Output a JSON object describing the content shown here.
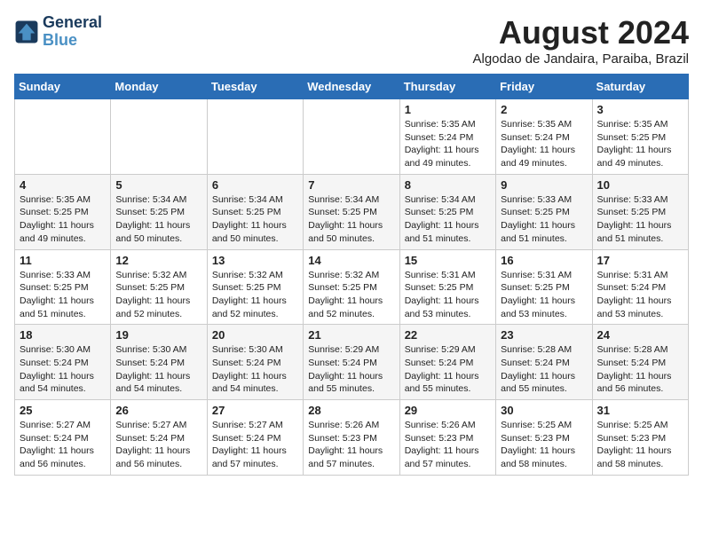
{
  "header": {
    "logo_line1": "General",
    "logo_line2": "Blue",
    "month_year": "August 2024",
    "location": "Algodao de Jandaira, Paraiba, Brazil"
  },
  "weekdays": [
    "Sunday",
    "Monday",
    "Tuesday",
    "Wednesday",
    "Thursday",
    "Friday",
    "Saturday"
  ],
  "weeks": [
    [
      {
        "day": "",
        "info": ""
      },
      {
        "day": "",
        "info": ""
      },
      {
        "day": "",
        "info": ""
      },
      {
        "day": "",
        "info": ""
      },
      {
        "day": "1",
        "info": "Sunrise: 5:35 AM\nSunset: 5:24 PM\nDaylight: 11 hours and 49 minutes."
      },
      {
        "day": "2",
        "info": "Sunrise: 5:35 AM\nSunset: 5:24 PM\nDaylight: 11 hours and 49 minutes."
      },
      {
        "day": "3",
        "info": "Sunrise: 5:35 AM\nSunset: 5:25 PM\nDaylight: 11 hours and 49 minutes."
      }
    ],
    [
      {
        "day": "4",
        "info": "Sunrise: 5:35 AM\nSunset: 5:25 PM\nDaylight: 11 hours and 49 minutes."
      },
      {
        "day": "5",
        "info": "Sunrise: 5:34 AM\nSunset: 5:25 PM\nDaylight: 11 hours and 50 minutes."
      },
      {
        "day": "6",
        "info": "Sunrise: 5:34 AM\nSunset: 5:25 PM\nDaylight: 11 hours and 50 minutes."
      },
      {
        "day": "7",
        "info": "Sunrise: 5:34 AM\nSunset: 5:25 PM\nDaylight: 11 hours and 50 minutes."
      },
      {
        "day": "8",
        "info": "Sunrise: 5:34 AM\nSunset: 5:25 PM\nDaylight: 11 hours and 51 minutes."
      },
      {
        "day": "9",
        "info": "Sunrise: 5:33 AM\nSunset: 5:25 PM\nDaylight: 11 hours and 51 minutes."
      },
      {
        "day": "10",
        "info": "Sunrise: 5:33 AM\nSunset: 5:25 PM\nDaylight: 11 hours and 51 minutes."
      }
    ],
    [
      {
        "day": "11",
        "info": "Sunrise: 5:33 AM\nSunset: 5:25 PM\nDaylight: 11 hours and 51 minutes."
      },
      {
        "day": "12",
        "info": "Sunrise: 5:32 AM\nSunset: 5:25 PM\nDaylight: 11 hours and 52 minutes."
      },
      {
        "day": "13",
        "info": "Sunrise: 5:32 AM\nSunset: 5:25 PM\nDaylight: 11 hours and 52 minutes."
      },
      {
        "day": "14",
        "info": "Sunrise: 5:32 AM\nSunset: 5:25 PM\nDaylight: 11 hours and 52 minutes."
      },
      {
        "day": "15",
        "info": "Sunrise: 5:31 AM\nSunset: 5:25 PM\nDaylight: 11 hours and 53 minutes."
      },
      {
        "day": "16",
        "info": "Sunrise: 5:31 AM\nSunset: 5:25 PM\nDaylight: 11 hours and 53 minutes."
      },
      {
        "day": "17",
        "info": "Sunrise: 5:31 AM\nSunset: 5:24 PM\nDaylight: 11 hours and 53 minutes."
      }
    ],
    [
      {
        "day": "18",
        "info": "Sunrise: 5:30 AM\nSunset: 5:24 PM\nDaylight: 11 hours and 54 minutes."
      },
      {
        "day": "19",
        "info": "Sunrise: 5:30 AM\nSunset: 5:24 PM\nDaylight: 11 hours and 54 minutes."
      },
      {
        "day": "20",
        "info": "Sunrise: 5:30 AM\nSunset: 5:24 PM\nDaylight: 11 hours and 54 minutes."
      },
      {
        "day": "21",
        "info": "Sunrise: 5:29 AM\nSunset: 5:24 PM\nDaylight: 11 hours and 55 minutes."
      },
      {
        "day": "22",
        "info": "Sunrise: 5:29 AM\nSunset: 5:24 PM\nDaylight: 11 hours and 55 minutes."
      },
      {
        "day": "23",
        "info": "Sunrise: 5:28 AM\nSunset: 5:24 PM\nDaylight: 11 hours and 55 minutes."
      },
      {
        "day": "24",
        "info": "Sunrise: 5:28 AM\nSunset: 5:24 PM\nDaylight: 11 hours and 56 minutes."
      }
    ],
    [
      {
        "day": "25",
        "info": "Sunrise: 5:27 AM\nSunset: 5:24 PM\nDaylight: 11 hours and 56 minutes."
      },
      {
        "day": "26",
        "info": "Sunrise: 5:27 AM\nSunset: 5:24 PM\nDaylight: 11 hours and 56 minutes."
      },
      {
        "day": "27",
        "info": "Sunrise: 5:27 AM\nSunset: 5:24 PM\nDaylight: 11 hours and 57 minutes."
      },
      {
        "day": "28",
        "info": "Sunrise: 5:26 AM\nSunset: 5:23 PM\nDaylight: 11 hours and 57 minutes."
      },
      {
        "day": "29",
        "info": "Sunrise: 5:26 AM\nSunset: 5:23 PM\nDaylight: 11 hours and 57 minutes."
      },
      {
        "day": "30",
        "info": "Sunrise: 5:25 AM\nSunset: 5:23 PM\nDaylight: 11 hours and 58 minutes."
      },
      {
        "day": "31",
        "info": "Sunrise: 5:25 AM\nSunset: 5:23 PM\nDaylight: 11 hours and 58 minutes."
      }
    ]
  ]
}
